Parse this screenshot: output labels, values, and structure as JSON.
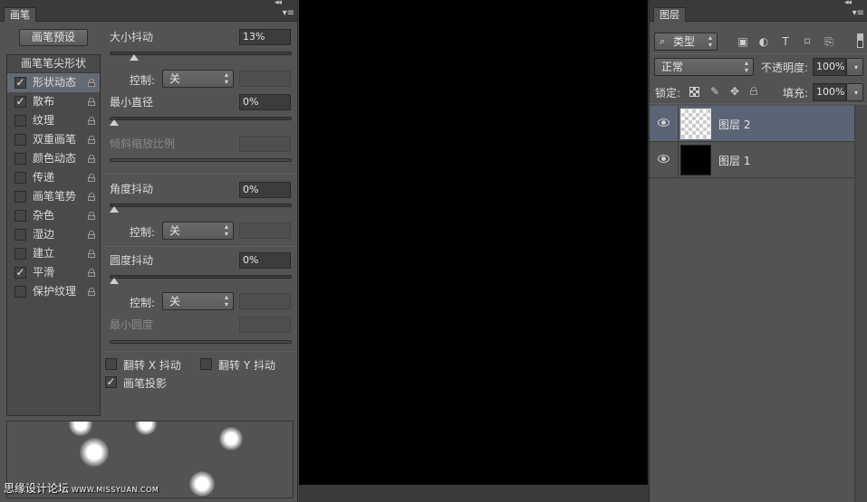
{
  "brush_panel": {
    "tab": "画笔",
    "presets_button": "画笔预设",
    "list_header": "画笔笔尖形状",
    "items": [
      {
        "label": "形状动态",
        "checked": true,
        "selected": true
      },
      {
        "label": "散布",
        "checked": true,
        "selected": false
      },
      {
        "label": "纹理",
        "checked": false,
        "selected": false
      },
      {
        "label": "双重画笔",
        "checked": false,
        "selected": false
      },
      {
        "label": "颜色动态",
        "checked": false,
        "selected": false
      },
      {
        "label": "传递",
        "checked": false,
        "selected": false
      },
      {
        "label": "画笔笔势",
        "checked": false,
        "selected": false
      },
      {
        "label": "杂色",
        "checked": false,
        "selected": false
      },
      {
        "label": "湿边",
        "checked": false,
        "selected": false
      },
      {
        "label": "建立",
        "checked": false,
        "selected": false
      },
      {
        "label": "平滑",
        "checked": true,
        "selected": false
      },
      {
        "label": "保护纹理",
        "checked": false,
        "selected": false
      }
    ],
    "check_mark": "✓",
    "size_jitter": {
      "label": "大小抖动",
      "value": "13%",
      "slider": 0.13
    },
    "control_1": {
      "label": "控制:",
      "value": "关"
    },
    "min_diameter": {
      "label": "最小直径",
      "value": "0%",
      "slider": 0
    },
    "tilt_scale": {
      "label": "倾斜缩放比例"
    },
    "angle_jitter": {
      "label": "角度抖动",
      "value": "0%",
      "slider": 0
    },
    "control_2": {
      "label": "控制:",
      "value": "关"
    },
    "roundness_jitter": {
      "label": "圆度抖动",
      "value": "0%",
      "slider": 0
    },
    "control_3": {
      "label": "控制:",
      "value": "关"
    },
    "min_roundness": {
      "label": "最小圆度"
    },
    "flip_x": {
      "label": "翻转 X 抖动",
      "checked": false
    },
    "flip_y": {
      "label": "翻转 Y 抖动",
      "checked": false
    },
    "brush_projection": {
      "label": "画笔投影",
      "checked": true
    }
  },
  "watermark": {
    "text": "思缘设计论坛",
    "url": "WWW.MISSYUAN.COM"
  },
  "layers_panel": {
    "tab": "图层",
    "filter_type": "类型",
    "blend_mode": "正常",
    "opacity_label": "不透明度:",
    "opacity_value": "100%",
    "lock_label": "锁定:",
    "fill_label": "填充:",
    "fill_value": "100%",
    "layers": [
      {
        "name": "图层 2",
        "thumbnail": "transparent",
        "selected": true
      },
      {
        "name": "图层 1",
        "thumbnail": "black",
        "selected": false
      }
    ]
  },
  "icons": {
    "collapse": "◂◂",
    "panel_menu": "▾≡",
    "dropdown": "▴▾",
    "search": "⌕",
    "filter_image": "▣",
    "filter_adjust": "◐",
    "filter_text": "T",
    "filter_shape": "⌑",
    "filter_smart": "⎘",
    "lock_position": "✥",
    "lock_paint": "✎"
  },
  "colors": {
    "canvas": "#000000",
    "panel_bg": "#535353",
    "selection": "#5b6475"
  }
}
